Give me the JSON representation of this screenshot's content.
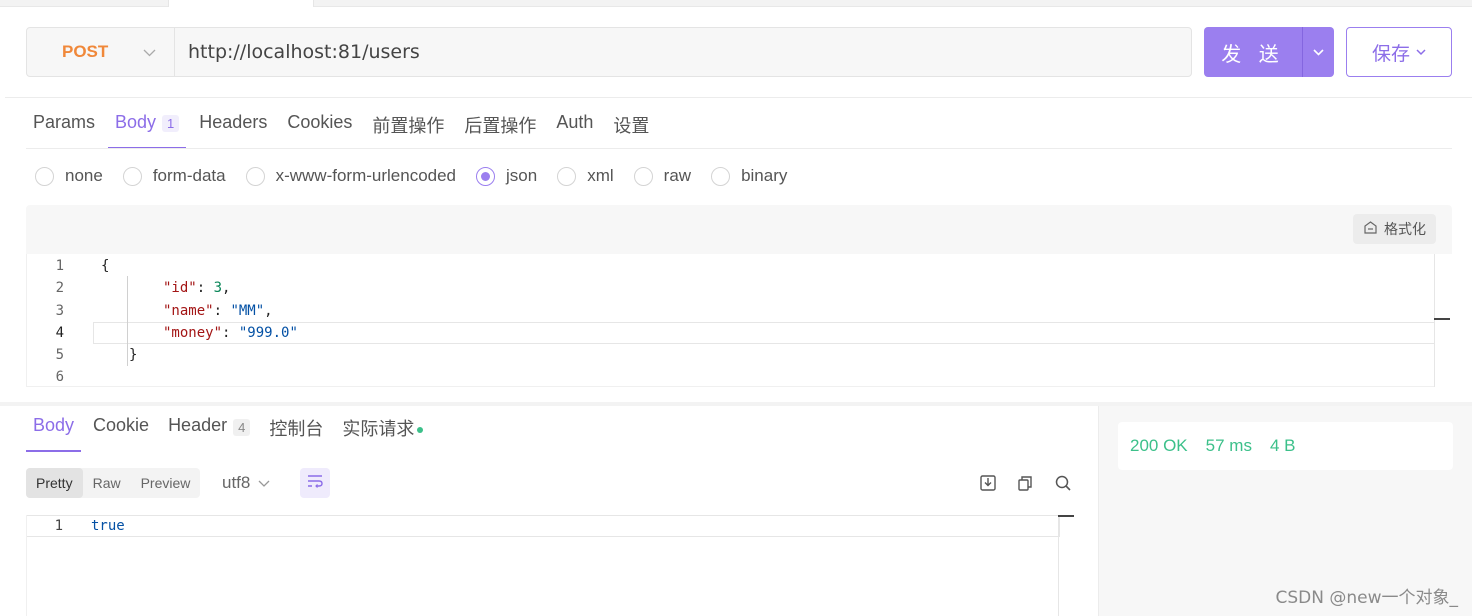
{
  "request": {
    "method": "POST",
    "url": "http://localhost:81/users",
    "send_label": "发 送",
    "save_label": "保存"
  },
  "request_tabs": [
    {
      "label": "Params"
    },
    {
      "label": "Body",
      "badge": "1",
      "active": true
    },
    {
      "label": "Headers"
    },
    {
      "label": "Cookies"
    },
    {
      "label": "前置操作"
    },
    {
      "label": "后置操作"
    },
    {
      "label": "Auth"
    },
    {
      "label": "设置"
    }
  ],
  "body_types": [
    {
      "label": "none"
    },
    {
      "label": "form-data"
    },
    {
      "label": "x-www-form-urlencoded"
    },
    {
      "label": "json",
      "checked": true
    },
    {
      "label": "xml"
    },
    {
      "label": "raw"
    },
    {
      "label": "binary"
    }
  ],
  "editor": {
    "format_label": "格式化",
    "line_numbers": [
      "1",
      "2",
      "3",
      "4",
      "5",
      "6"
    ]
  },
  "json_body": {
    "open": "{",
    "close": "}",
    "fields": [
      {
        "key": "\"id\"",
        "value": "3",
        "sep": ","
      },
      {
        "key": "\"name\"",
        "value": "\"MM\"",
        "sep": ","
      },
      {
        "key": "\"money\"",
        "value": "\"999.0\"",
        "sep": ""
      }
    ]
  },
  "response_tabs": [
    {
      "label": "Body",
      "active": true
    },
    {
      "label": "Cookie"
    },
    {
      "label": "Header",
      "badge": "4"
    },
    {
      "label": "控制台"
    },
    {
      "label": "实际请求",
      "dot": true
    }
  ],
  "response_view": {
    "options": [
      "Pretty",
      "Raw",
      "Preview"
    ],
    "active": "Pretty",
    "encoding": "utf8",
    "line_number": "1",
    "content": "true"
  },
  "status": {
    "code": "200 OK",
    "time": "57 ms",
    "size": "4 B"
  },
  "icons": [
    "chevron-down-icon",
    "format-icon",
    "wrap-icon",
    "download-icon",
    "copy-icon",
    "search-icon"
  ],
  "colors": {
    "accent": "#9b7fef",
    "method": "#f0883a",
    "success": "#3cc08a"
  },
  "watermark": "CSDN @new一个对象_"
}
